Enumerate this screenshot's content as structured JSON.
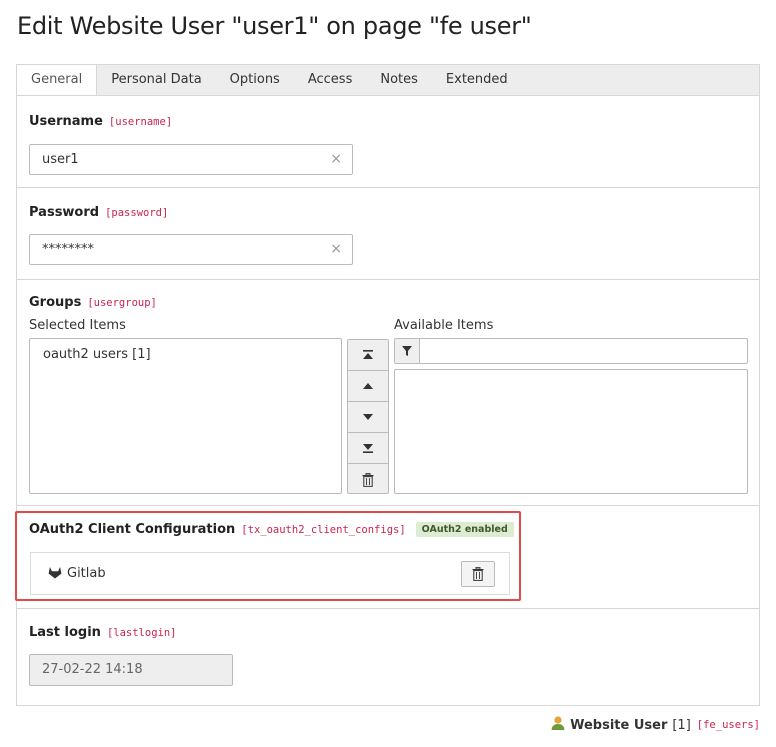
{
  "page": {
    "title": "Edit Website User \"user1\" on page \"fe user\""
  },
  "tabs": [
    {
      "label": "General",
      "active": true
    },
    {
      "label": "Personal Data"
    },
    {
      "label": "Options"
    },
    {
      "label": "Access"
    },
    {
      "label": "Notes"
    },
    {
      "label": "Extended"
    }
  ],
  "username": {
    "label": "Username",
    "field": "[username]",
    "value": "user1",
    "clear": "×"
  },
  "password": {
    "label": "Password",
    "field": "[password]",
    "value": "********",
    "clear": "×"
  },
  "groups": {
    "label": "Groups",
    "field": "[usergroup]",
    "selected_label": "Selected Items",
    "available_label": "Available Items",
    "selected_items": [
      "oauth2 users [1]"
    ],
    "filter_value": ""
  },
  "oauth": {
    "label": "OAuth2 Client Configuration",
    "field": "[tx_oauth2_client_configs]",
    "badge": "OAuth2 enabled",
    "provider": "Gitlab"
  },
  "lastlogin": {
    "label": "Last login",
    "field": "[lastlogin]",
    "value": "27-02-22 14:18"
  },
  "footer": {
    "record_type": "Website User",
    "uid": "[1]",
    "table": "[fe_users]"
  },
  "colors": {
    "field_name": "#c7254e",
    "highlight": "#e24a4a",
    "badge_bg": "#dcebd1"
  }
}
